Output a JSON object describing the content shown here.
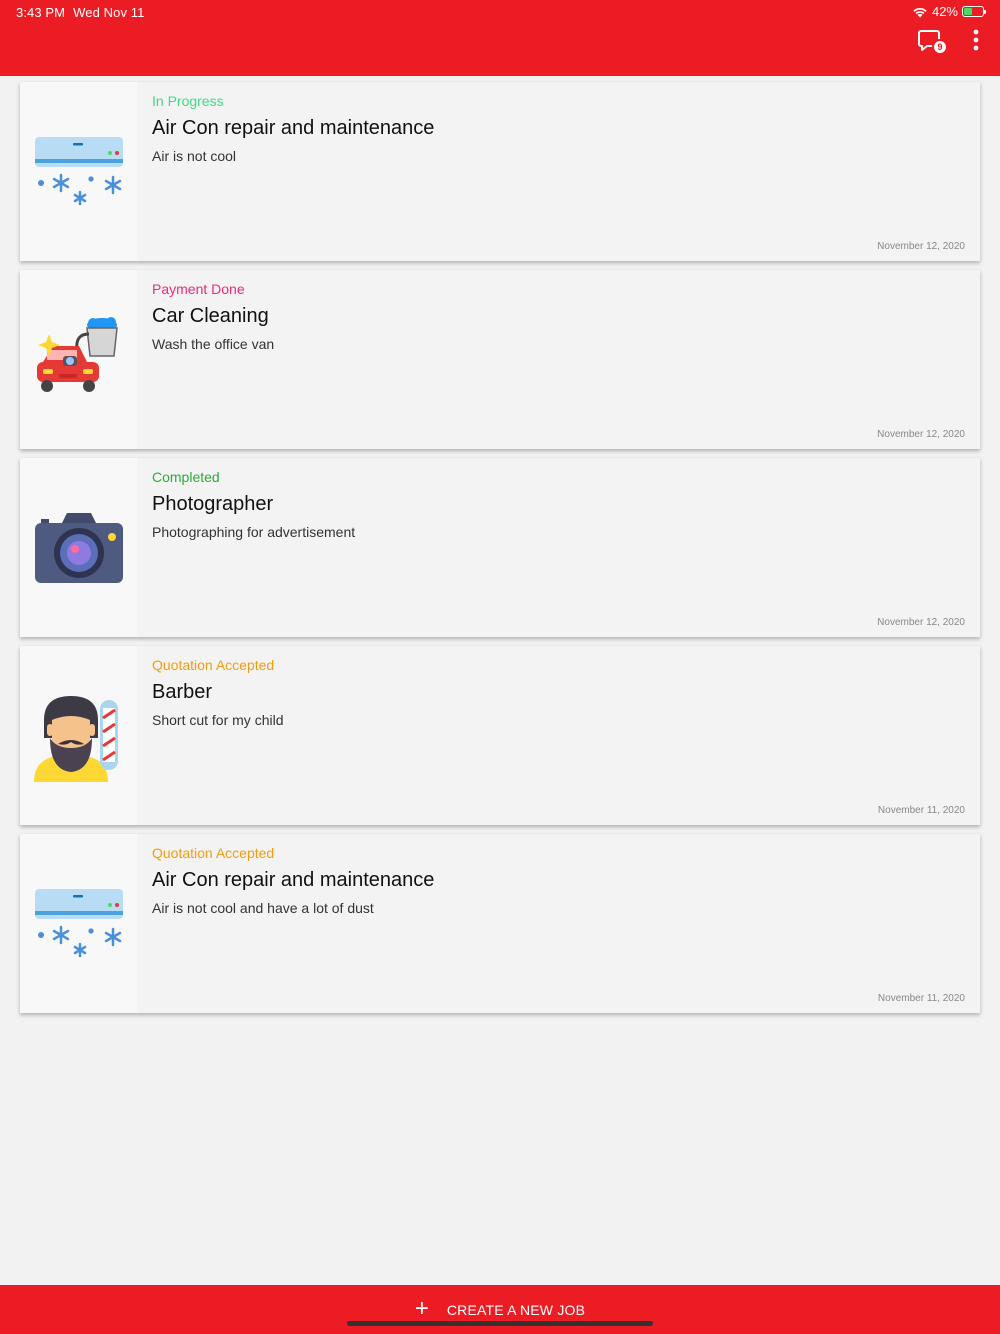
{
  "status_bar": {
    "time": "3:43 PM",
    "date": "Wed Nov 11",
    "battery": "42%",
    "battery_level": 0.42
  },
  "header": {
    "chat_badge": "9"
  },
  "colors": {
    "brand_red": "#eb1c24",
    "in_progress": "#3ddc84",
    "payment_done": "#ee2a7b",
    "completed": "#2eaa3b",
    "quotation_accepted": "#f39c12"
  },
  "jobs": [
    {
      "status": "In Progress",
      "status_color": "#3ddc84",
      "title": "Air Con repair and maintenance",
      "description": "Air is not cool",
      "date": "November 12, 2020",
      "icon": "air-conditioner-icon"
    },
    {
      "status": "Payment Done",
      "status_color": "#ee2a7b",
      "title": "Car Cleaning",
      "description": "Wash the office van",
      "date": "November 12, 2020",
      "icon": "car-wash-icon"
    },
    {
      "status": "Completed",
      "status_color": "#2eaa3b",
      "title": "Photographer",
      "description": "Photographing for advertisement",
      "date": "November 12, 2020",
      "icon": "camera-icon"
    },
    {
      "status": "Quotation Accepted",
      "status_color": "#f39c12",
      "title": "Barber",
      "description": "Short cut for my child",
      "date": "November 11, 2020",
      "icon": "barber-icon"
    },
    {
      "status": "Quotation Accepted",
      "status_color": "#f39c12",
      "title": "Air Con repair and maintenance",
      "description": "Air is not cool and have a lot of dust",
      "date": "November 11, 2020",
      "icon": "air-conditioner-icon"
    }
  ],
  "footer": {
    "create_label": "CREATE A NEW JOB"
  }
}
